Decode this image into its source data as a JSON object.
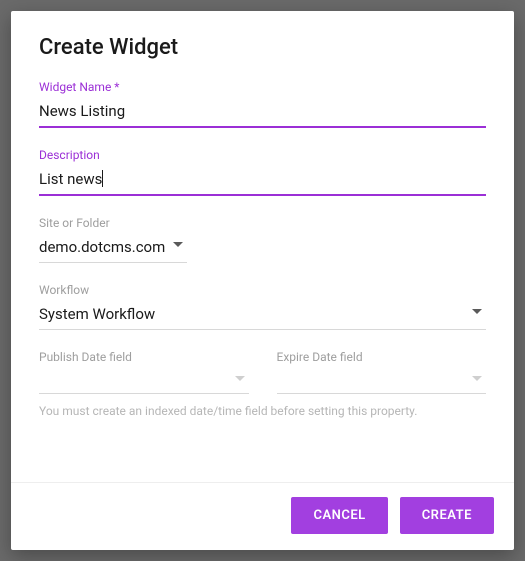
{
  "dialog": {
    "title": "Create Widget"
  },
  "fields": {
    "name": {
      "label": "Widget Name *",
      "value": "News Listing"
    },
    "description": {
      "label": "Description",
      "value": "List news"
    },
    "siteFolder": {
      "label": "Site or Folder",
      "value": "demo.dotcms.com"
    },
    "workflow": {
      "label": "Workflow",
      "value": "System Workflow"
    },
    "publishDate": {
      "label": "Publish Date field",
      "value": ""
    },
    "expireDate": {
      "label": "Expire Date field",
      "value": ""
    },
    "hint": "You must create an indexed date/time field before setting this property."
  },
  "buttons": {
    "cancel": "CANCEL",
    "create": "CREATE"
  }
}
